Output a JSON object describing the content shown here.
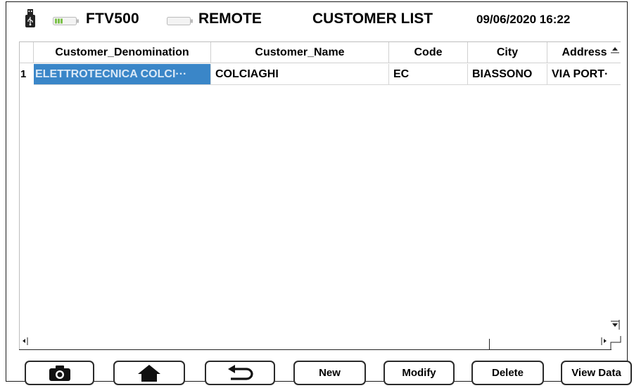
{
  "header": {
    "device_name": "FTV500",
    "mode": "REMOTE",
    "title": "CUSTOMER LIST",
    "datetime": "09/06/2020 16:22"
  },
  "table": {
    "columns": [
      "Customer_Denomination",
      "Customer_Name",
      "Code",
      "City",
      "Address"
    ],
    "rows": [
      {
        "index": "1",
        "cells": [
          "ELETTROTECNICA COLCI···",
          "COLCIAGHI",
          "EC",
          "BIASSONO",
          "VIA PORT·"
        ]
      }
    ],
    "selected_row": 0,
    "selected_column": 0
  },
  "buttons": {
    "camera_icon": "camera-icon",
    "home_icon": "home-icon",
    "back_icon": "back-arrow-icon",
    "new": "New",
    "modify": "Modify",
    "delete": "Delete",
    "view_data": "View Data"
  },
  "colors": {
    "selection": "#3a86c8",
    "battery_green": "#7cc24a"
  }
}
